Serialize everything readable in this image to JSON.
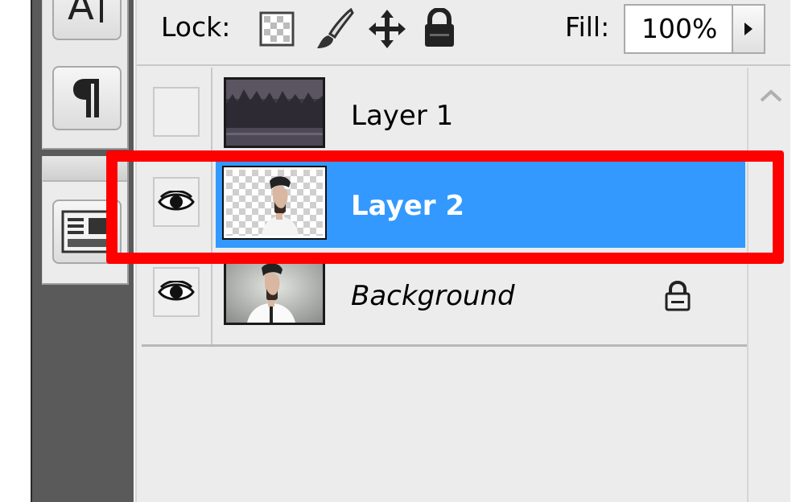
{
  "lock": {
    "label": "Lock:",
    "icons": [
      "lock-transparent-pixels-icon",
      "lock-image-pixels-icon",
      "lock-position-icon",
      "lock-all-icon"
    ]
  },
  "fill": {
    "label": "Fill:",
    "value": "100%"
  },
  "tools": [
    "character-icon",
    "paragraph-icon",
    "panel-options-icon"
  ],
  "layers": [
    {
      "name": "Layer 1",
      "visible": false,
      "selected": false,
      "locked": false,
      "thumbnail": "dark-landscape-thumbnail"
    },
    {
      "name": "Layer 2",
      "visible": true,
      "selected": true,
      "locked": false,
      "thumbnail": "portrait-transparent-thumbnail"
    },
    {
      "name": "Background",
      "visible": true,
      "selected": false,
      "locked": true,
      "thumbnail": "portrait-background-thumbnail"
    }
  ],
  "colors": {
    "selection": "#3399ff",
    "highlight": "#ff0000",
    "panel": "#ececec"
  }
}
